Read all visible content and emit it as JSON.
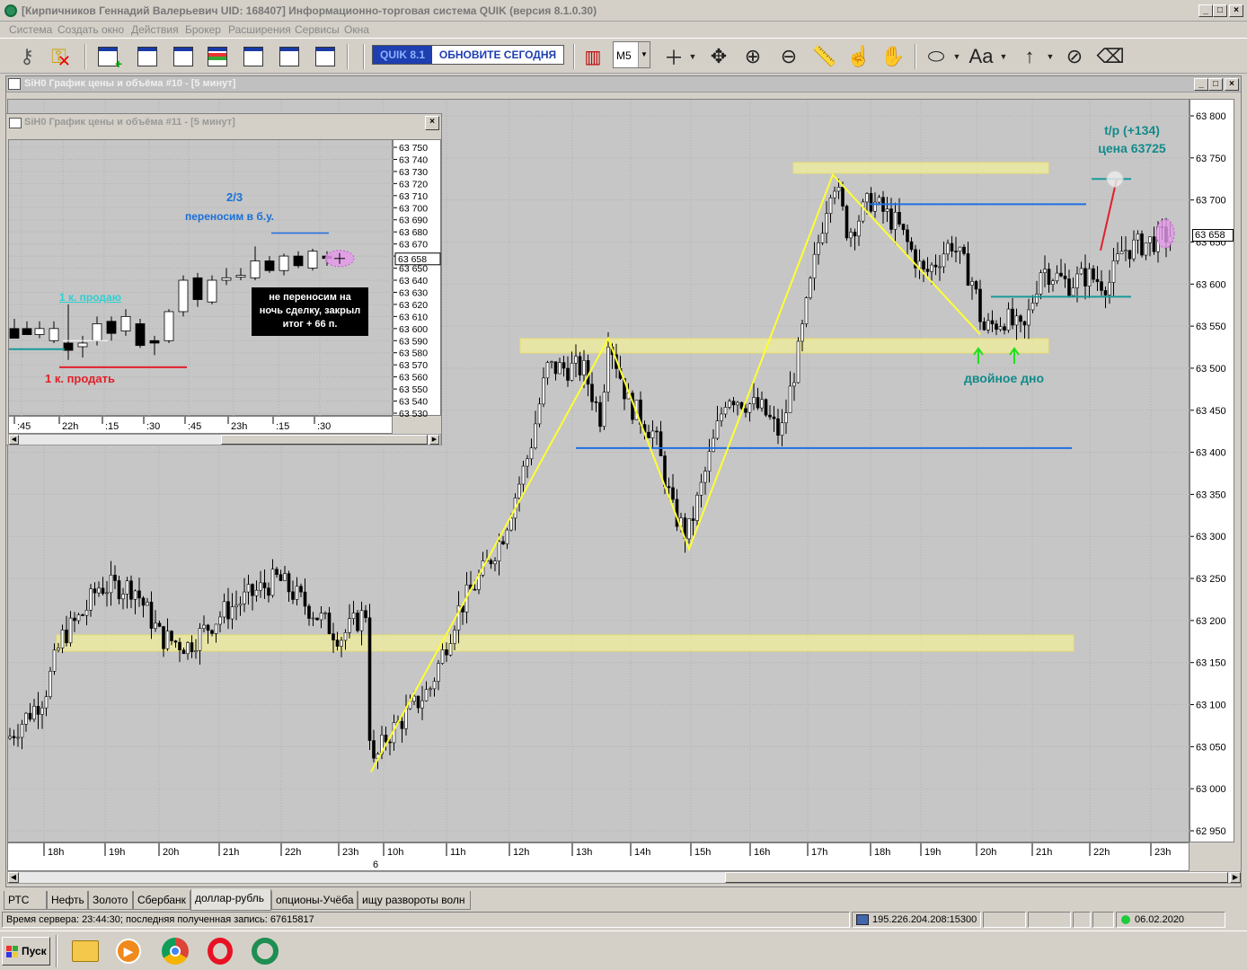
{
  "window": {
    "title": "[Кирпичников Геннадий Валерьевич UID: 168407] Информационно-торговая система QUIK (версия 8.1.0.30)"
  },
  "menu": [
    "Система",
    "Создать окно",
    "Действия",
    "Брокер",
    "Расширения",
    "Сервисы",
    "Окна"
  ],
  "toolbar": {
    "badge_left": "QUIK 8.1",
    "badge_right": "ОБНОВИТЕ СЕГОДНЯ",
    "timeframe": "M5",
    "font_tool": "Aa"
  },
  "main_chart": {
    "title": "SiH0 График цены и объёма #10 - [5 минут]",
    "price_ticks": [
      "63 800",
      "63 750",
      "63 700",
      "63 650",
      "63 600",
      "63 550",
      "63 500",
      "63 450",
      "63 400",
      "63 350",
      "63 300",
      "63 250",
      "63 200",
      "63 150",
      "63 100",
      "63 050",
      "63 000",
      "62 950"
    ],
    "current_price": "63 658",
    "time_labels": [
      "18h",
      "19h",
      "20h",
      "21h",
      "22h",
      "23h",
      "10h",
      "11h",
      "12h",
      "13h",
      "14h",
      "15h",
      "16h",
      "17h",
      "18h",
      "19h",
      "20h",
      "21h",
      "22h",
      "23h"
    ],
    "date_label": "6",
    "annotations": {
      "tp_line1": "t/p (+134)",
      "tp_line2": "цена  63725",
      "double_bottom": "двойное дно"
    }
  },
  "sub_chart": {
    "title": "SiH0 График цены и объёма #11 - [5 минут]",
    "price_ticks": [
      "63 750",
      "63 740",
      "63 730",
      "63 720",
      "63 710",
      "63 700",
      "63 690",
      "63 680",
      "63 670",
      "63 660",
      "63 650",
      "63 640",
      "63 630",
      "63 620",
      "63 610",
      "63 600",
      "63 590",
      "63 580",
      "63 570",
      "63 560",
      "63 550",
      "63 540",
      "63 530"
    ],
    "current_price": "63 658",
    "time_labels": [
      ":45",
      "22h",
      ":15",
      ":30",
      ":45",
      "23h",
      ":15",
      ":30"
    ],
    "annotations": {
      "frac": "2/3",
      "move_be": "переносим в б.у.",
      "sell_1k_teal": "1 к. продаю",
      "sell_1k_red": "1 к. продать",
      "note_l1": "не переносим на",
      "note_l2": "ночь сделку, закрыл",
      "note_l3": "итог + 66 п."
    }
  },
  "tabs": [
    "РТС",
    "Нефть",
    "Золото",
    "Сбербанк",
    "доллар-рубль",
    "опционы-Учёба",
    "ищу развороты волн"
  ],
  "active_tab": "доллар-рубль",
  "status": {
    "server_time": "Время сервера: 23:44:30; последняя полученная запись: 67615817",
    "connection": "195.226.204.208:15300",
    "date": "06.02.2020"
  },
  "taskbar": {
    "start": "Пуск"
  },
  "colors": {
    "chart_bg": "#c6c6c6",
    "zone_yellow": "#f2ef9a",
    "wave_line": "#ffff33",
    "level_blue": "#1f6fe0",
    "level_teal": "#1a9a9a",
    "tp_red": "#e0202a",
    "annotation_teal": "#138a8a",
    "annotation_blue": "#1a6fd8"
  }
}
